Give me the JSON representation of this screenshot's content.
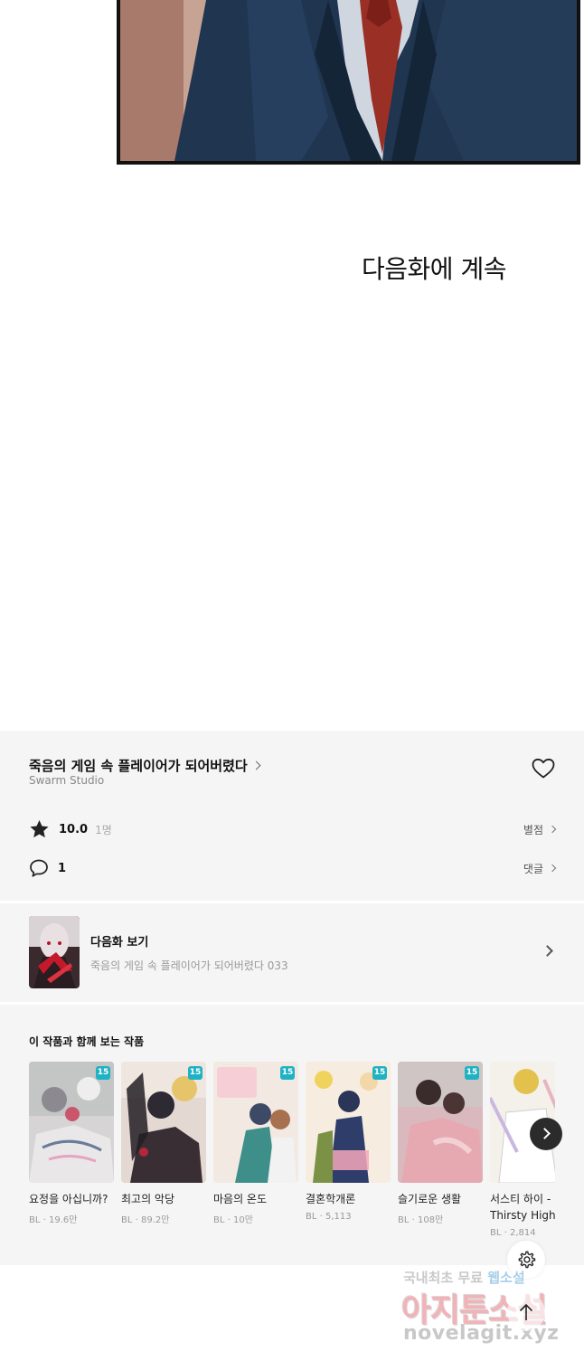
{
  "episode_end": {
    "next_caption": "다음화에 계속"
  },
  "series": {
    "title": "죽음의 게임 속 플레이어가 되어버렸다",
    "studio": "Swarm Studio",
    "rating_score": "10.0",
    "rating_count": "1명",
    "rating_link": "별점",
    "comment_count": "1",
    "comment_link": "댓글"
  },
  "next_episode": {
    "label": "다음화 보기",
    "title": "죽음의 게임 속 플레이어가 되어버렸다 033"
  },
  "recommendations": {
    "heading": "이 작품과 함께 보는 작품",
    "items": [
      {
        "title": "요정을 아십니까?",
        "genre": "BL",
        "views": "19.6만",
        "badge": "15"
      },
      {
        "title": "최고의 악당",
        "genre": "BL",
        "views": "89.2만",
        "badge": "15"
      },
      {
        "title": "마음의 온도",
        "genre": "BL",
        "views": "10만",
        "badge": "15"
      },
      {
        "title": "결혼학개론",
        "genre": "BL",
        "views": "5,113",
        "badge": "15"
      },
      {
        "title": "슬기로운 생활",
        "genre": "BL",
        "views": "108만",
        "badge": "15"
      },
      {
        "title": "서스티 하이 -Thirsty High- [...]",
        "genre": "BL",
        "views": "2,814",
        "badge": ""
      }
    ],
    "meta_separator": " · "
  },
  "watermark": {
    "line1_plain": "국내최초 무료 ",
    "line1_highlight": "웹소설",
    "line2": "아지툰소설",
    "line3": "novelagit.xyz"
  },
  "colors": {
    "info_background": "#f5f5f5",
    "age_badge": "#1fb2c4",
    "carousel_button": "#2b2b2b"
  },
  "icons": [
    "heart-icon",
    "star-icon",
    "comment-icon",
    "chevron-right-icon",
    "settings-gear-icon",
    "arrow-up-icon"
  ]
}
